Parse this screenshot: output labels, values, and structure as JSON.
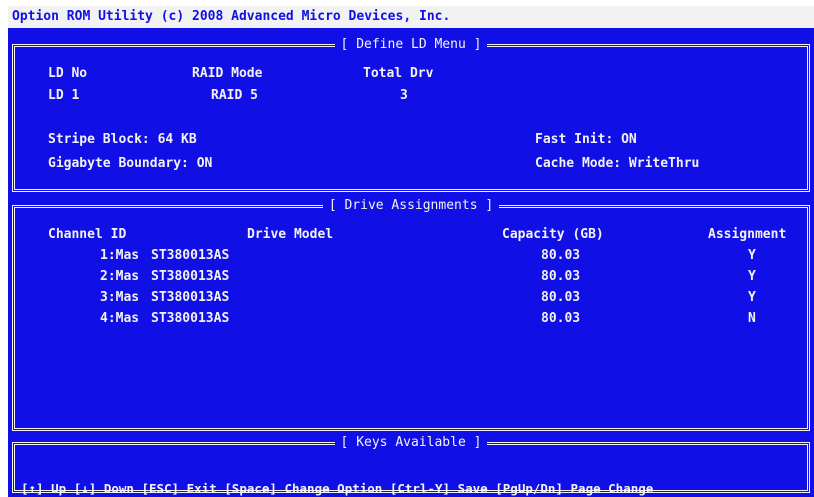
{
  "title": "Option ROM Utility (c) 2008 Advanced Micro Devices, Inc.",
  "define_ld": {
    "heading": "[ Define LD Menu ]",
    "col_ld_no": "LD No",
    "col_raid_mode": "RAID Mode",
    "col_total_drv": "Total Drv",
    "ld_no": "LD 1",
    "raid_mode": "RAID 5",
    "total_drv": "3",
    "stripe_block": "Stripe Block: 64 KB",
    "gigabyte_boundary": "Gigabyte Boundary: ON",
    "fast_init": "Fast Init: ON",
    "cache_mode": "Cache Mode: WriteThru"
  },
  "drive_assignments": {
    "heading": "[ Drive Assignments ]",
    "headers": {
      "channel_id": "Channel ID",
      "drive_model": "Drive Model",
      "capacity": "Capacity (GB)",
      "assignment": "Assignment"
    },
    "rows": [
      {
        "channel": "1:Mas",
        "model": "ST380013AS",
        "capacity": "80.03",
        "assignment": "Y"
      },
      {
        "channel": "2:Mas",
        "model": "ST380013AS",
        "capacity": "80.03",
        "assignment": "Y"
      },
      {
        "channel": "3:Mas",
        "model": "ST380013AS",
        "capacity": "80.03",
        "assignment": "Y"
      },
      {
        "channel": "4:Mas",
        "model": "ST380013AS",
        "capacity": "80.03",
        "assignment": "N"
      }
    ]
  },
  "keys": {
    "heading": "[ Keys Available ]",
    "items": [
      {
        "key": "[↑]",
        "action": "Up"
      },
      {
        "key": "[↓]",
        "action": "Down"
      },
      {
        "key": "[ESC]",
        "action": "Exit"
      },
      {
        "key": "[Space]",
        "action": "Change Option"
      },
      {
        "key": "[Ctrl-Y]",
        "action": "Save"
      },
      {
        "key": "[PgUp/Dn]",
        "action": "Page Change"
      }
    ]
  },
  "colors": {
    "background": "#1010e6",
    "text": "#f2f2f2"
  }
}
